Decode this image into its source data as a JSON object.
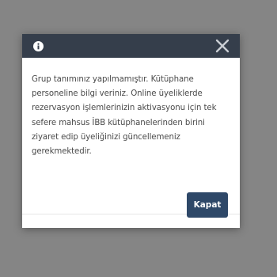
{
  "dialog": {
    "header": {
      "info_icon": "info-icon",
      "close_icon": "close-icon"
    },
    "message_lines": [
      "Grup tanımınız yapılmamıştır. Kütüphane",
      "personeline bilgi veriniz. Online üyeliklerde",
      "rezervasyon işlemlerinizin aktivasyonu için tek",
      "sefere mahsus İBB kütüphanelerinden birini",
      "ziyaret edip üyeliğinizi güncellemeniz",
      "gerekmektedir."
    ],
    "close_button_label": "Kapat"
  },
  "colors": {
    "backdrop": "#858585",
    "header": "#353e4b",
    "button": "#2e4868",
    "text": "#4a4a4a"
  }
}
